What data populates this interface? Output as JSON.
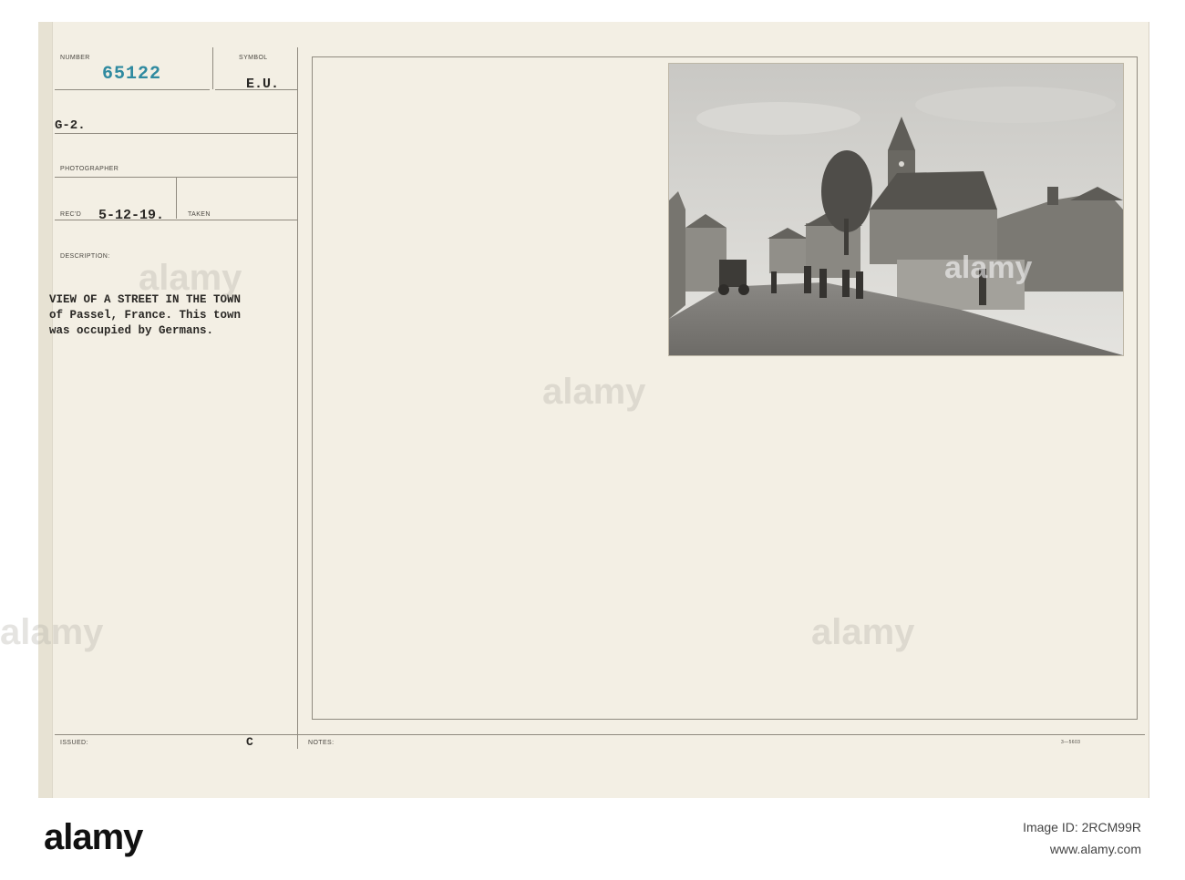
{
  "card": {
    "number_label": "NUMBER",
    "number_value": "65122",
    "symbol_label": "SYMBOL",
    "symbol_value": "E.U.",
    "g2": "G-2.",
    "photographer_label": "PHOTOGRAPHER",
    "recd_label": "REC'D",
    "recd_value": "5-12-19.",
    "taken_label": "TAKEN",
    "description_label": "DESCRIPTION:",
    "description_lines": [
      "VIEW OF A STREET IN THE TOWN",
      "of Passel, France. This town",
      "was occupied by Germans."
    ],
    "issued_label": "ISSUED:",
    "issued_value": "C",
    "notes_label": "NOTES:",
    "form_code": "3—5603"
  },
  "watermarks": [
    "alamy",
    "alamy",
    "alamy",
    "alamy",
    "alamy",
    "alamy"
  ],
  "footer": {
    "logo": "alamy",
    "image_id": "Image ID: 2RCM99R",
    "site": "www.alamy.com"
  },
  "colors": {
    "card_bg": "#f3efe4",
    "stamp_blue": "#2f8aa0",
    "line": "#8f8a7f"
  }
}
